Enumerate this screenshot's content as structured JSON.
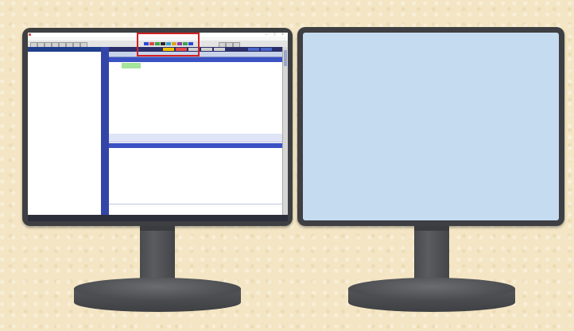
{
  "scene": {
    "background_color": "#f4e6c4",
    "monitor_color": "#3e3f42",
    "right_screen_color": "#c4dbf0",
    "highlight_color": "#d32121"
  },
  "app": {
    "title": "",
    "menu_items": [],
    "left_panel_title": "",
    "tree_nodes": [],
    "columns": [],
    "sections": [
      {
        "title": "",
        "rows": []
      },
      {
        "title": "",
        "rows": []
      }
    ],
    "status_text": ""
  }
}
